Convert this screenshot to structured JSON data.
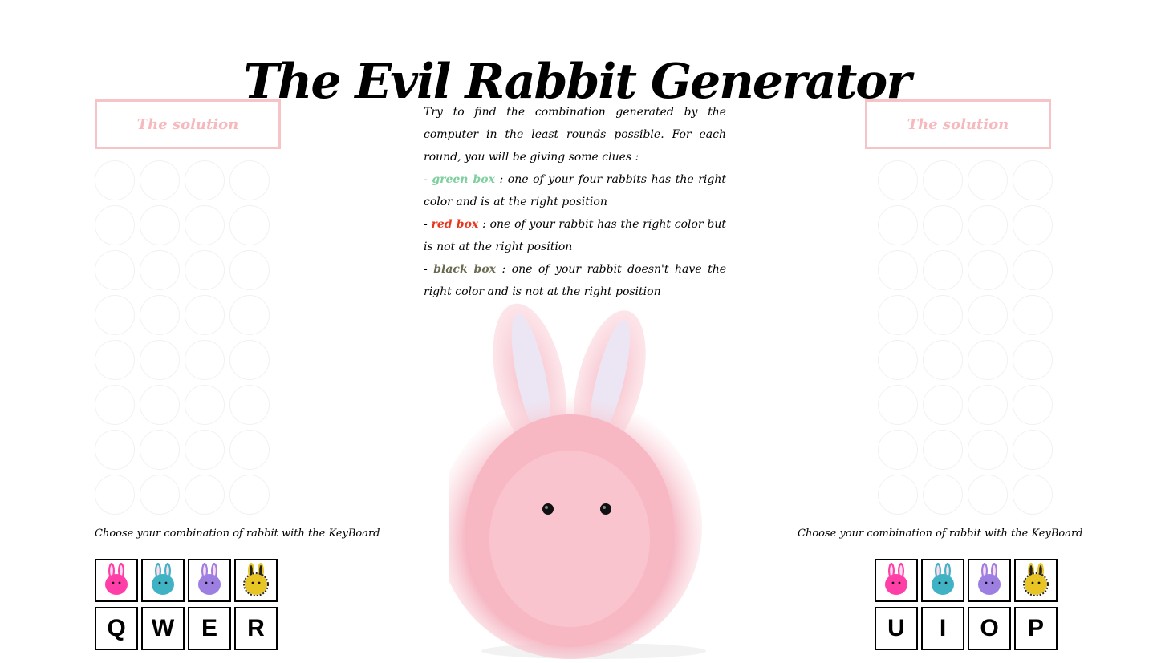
{
  "header": {
    "title": "The Evil Rabbit Generator"
  },
  "solution": {
    "label": "The solution"
  },
  "instructions": {
    "intro": "Try to find the combination generated by the computer in the least rounds possible. For each round, you will be giving some clues :",
    "clues": [
      {
        "name": "green box",
        "text": " : one of your four rabbits has the right color and is at the right position",
        "color": "#7fcf9f"
      },
      {
        "name": "red box",
        "text": " : one of your rabbit has the right color but is not at the right position",
        "color": "#e7361e"
      },
      {
        "name": "black box",
        "text": " : one of your rabbit doesn't have the right color and is not at the right position",
        "color": "#6b6b52"
      }
    ]
  },
  "choose_label": "Choose your combination of rabbit with the KeyBoard",
  "palette_colors": [
    {
      "icon": "pink-rabbit-icon",
      "color": "#ff3fa7"
    },
    {
      "icon": "teal-rabbit-icon",
      "color": "#3fb3c4"
    },
    {
      "icon": "purple-rabbit-icon",
      "color": "#9c7fe0"
    },
    {
      "icon": "yellow-black-rabbit-icon",
      "color": "#e8c425"
    }
  ],
  "left_keys": [
    "Q",
    "W",
    "E",
    "R"
  ],
  "right_keys": [
    "U",
    "I",
    "O",
    "P"
  ],
  "colors": {
    "solution_border": "#f6c3c7",
    "solution_text": "#f6b9bd",
    "bunny": "#f7b6c2"
  }
}
